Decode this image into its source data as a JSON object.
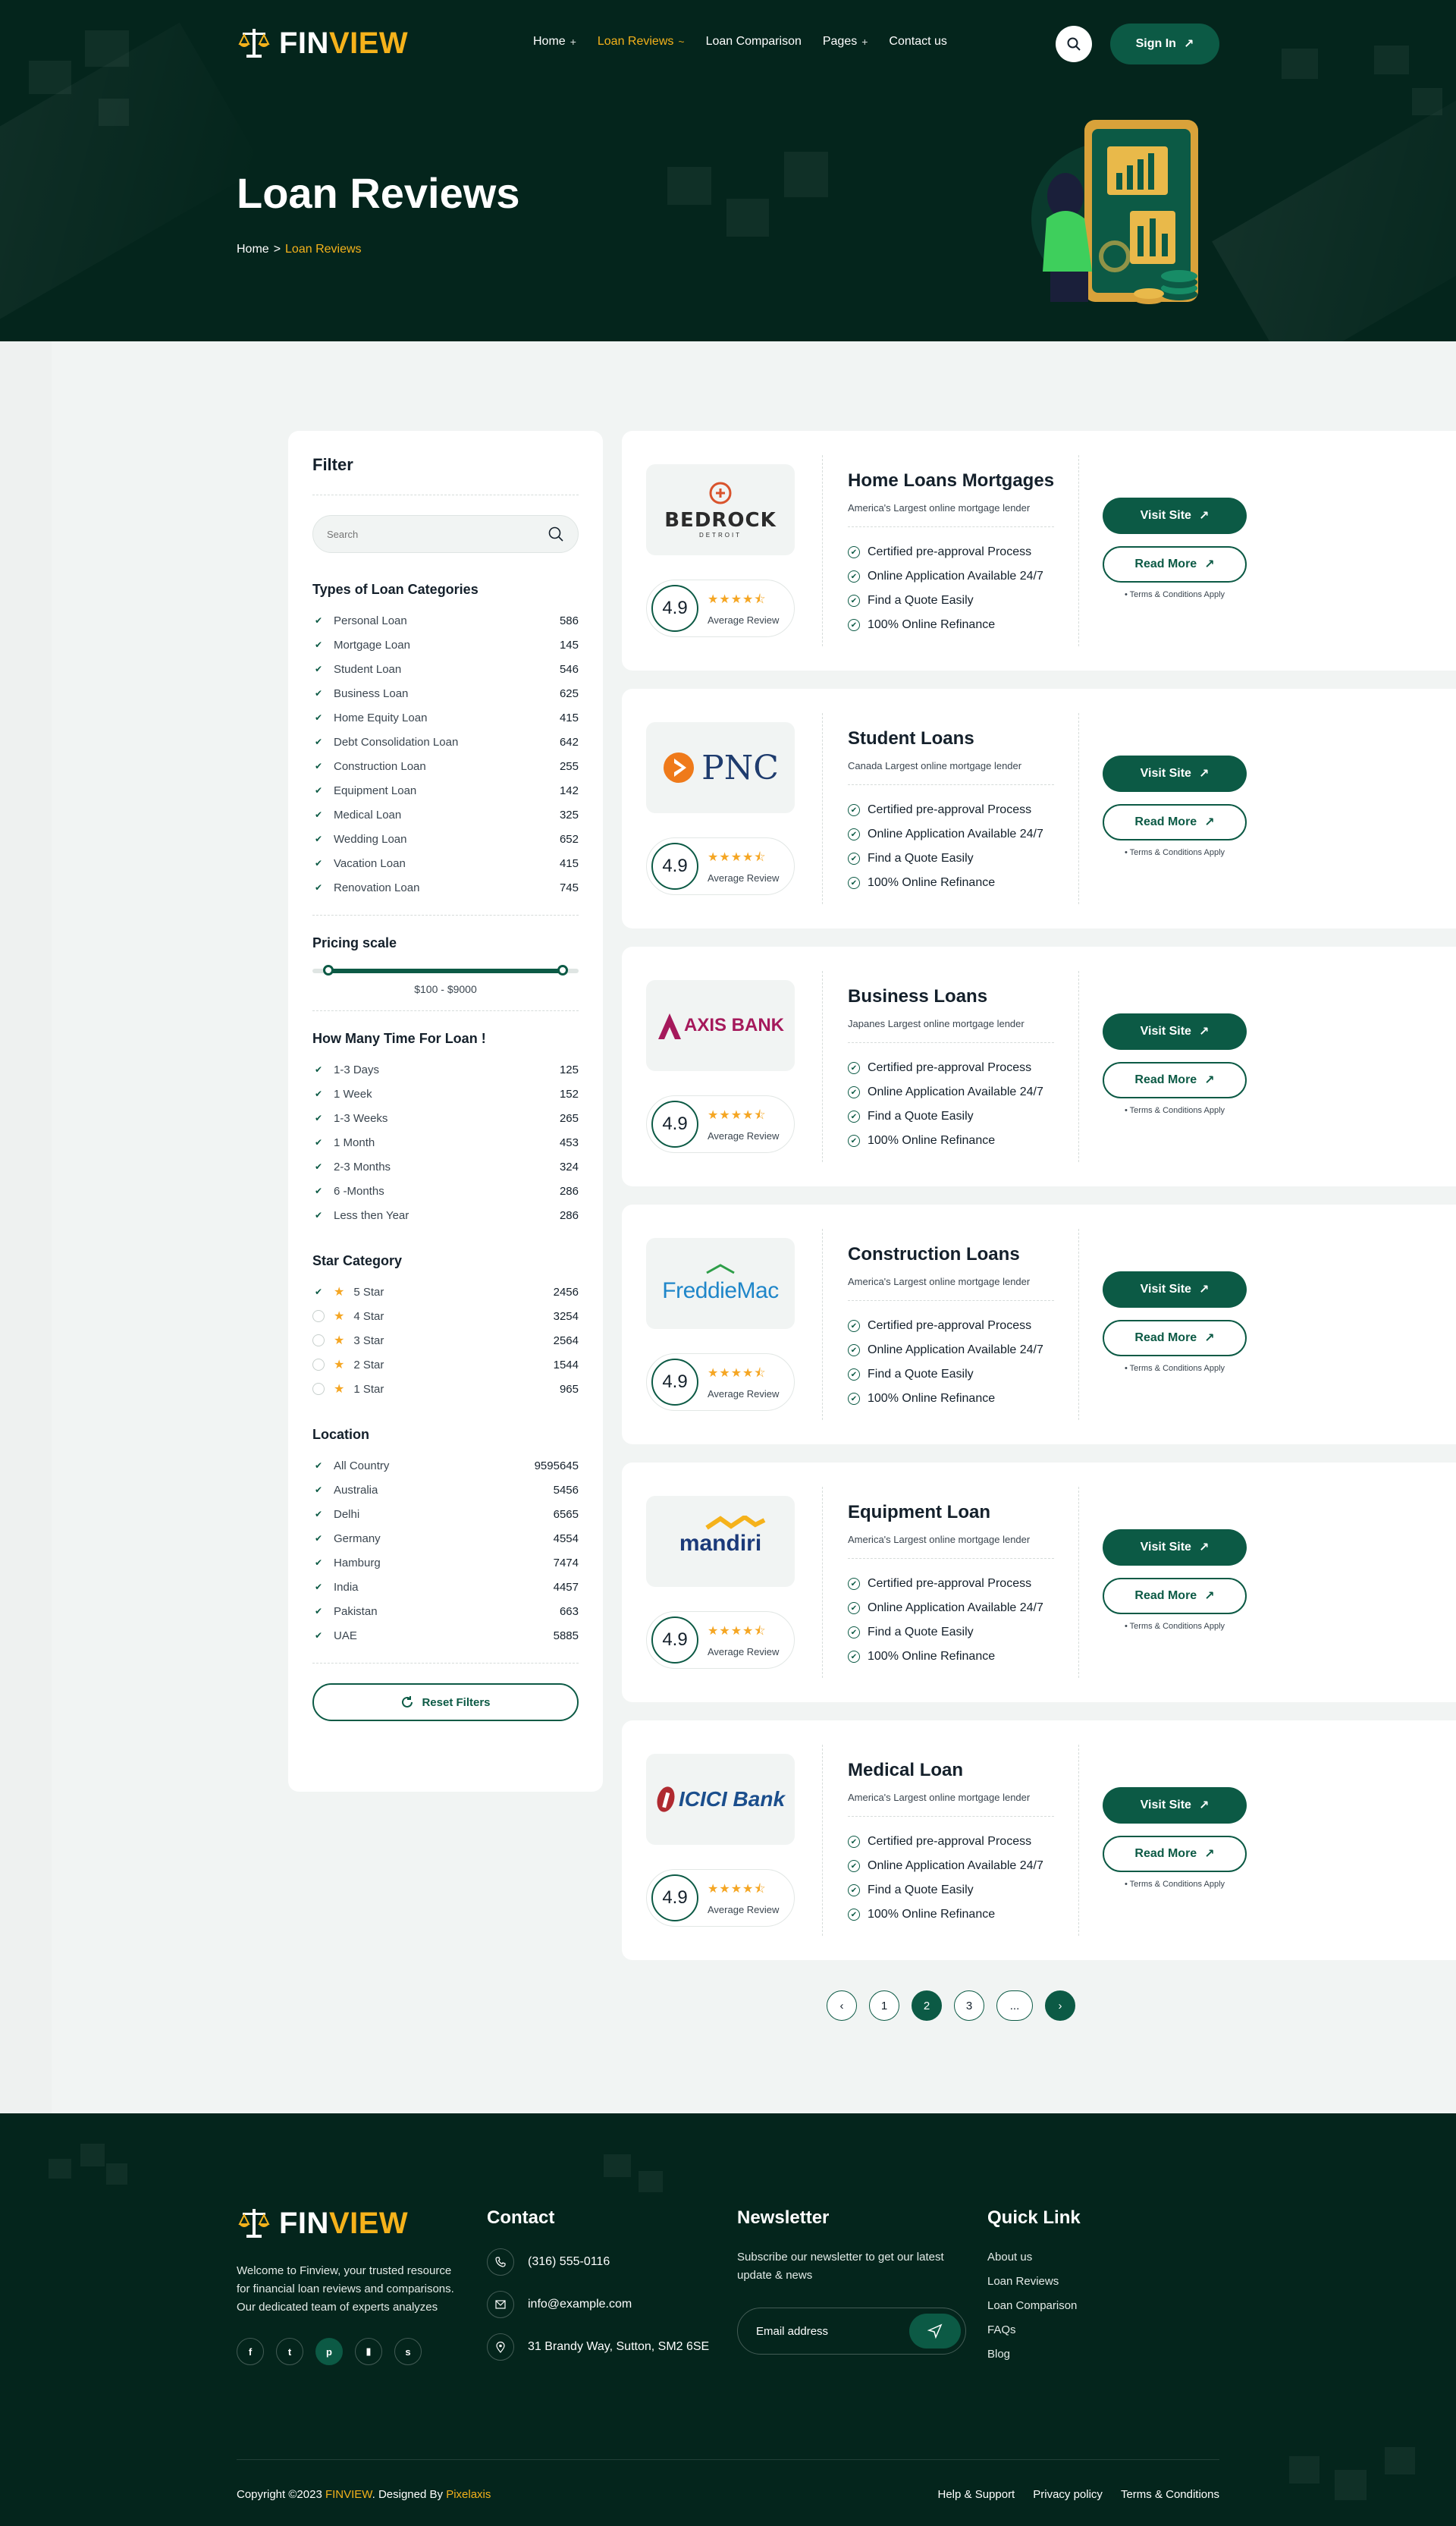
{
  "brand": {
    "name_part1": "FIN",
    "name_part2": "VIEW"
  },
  "nav": {
    "items": [
      {
        "label": "Home",
        "suffix": "+"
      },
      {
        "label": "Loan Reviews",
        "suffix": "~",
        "active": true
      },
      {
        "label": "Loan Comparison",
        "suffix": ""
      },
      {
        "label": "Pages",
        "suffix": "+"
      },
      {
        "label": "Contact us",
        "suffix": ""
      }
    ],
    "signin": "Sign In"
  },
  "hero": {
    "title": "Loan Reviews",
    "breadcrumb": {
      "home": "Home",
      "sep": ">",
      "current": "Loan Reviews"
    }
  },
  "filter": {
    "title": "Filter",
    "search_placeholder": "Search",
    "loan_types": {
      "heading": "Types of Loan Categories",
      "items": [
        {
          "label": "Personal Loan",
          "count": "586"
        },
        {
          "label": "Mortgage Loan",
          "count": "145"
        },
        {
          "label": "Student Loan",
          "count": "546"
        },
        {
          "label": "Business Loan",
          "count": "625"
        },
        {
          "label": "Home Equity Loan",
          "count": "415"
        },
        {
          "label": "Debt Consolidation Loan",
          "count": "642"
        },
        {
          "label": "Construction Loan",
          "count": "255"
        },
        {
          "label": "Equipment Loan",
          "count": "142"
        },
        {
          "label": "Medical Loan",
          "count": "325"
        },
        {
          "label": "Wedding Loan",
          "count": "652"
        },
        {
          "label": "Vacation Loan",
          "count": "415"
        },
        {
          "label": "Renovation Loan",
          "count": "745"
        }
      ]
    },
    "pricing": {
      "heading": "Pricing scale",
      "range_label": "$100 - $9000",
      "min_fraction": 0.06,
      "max_fraction": 0.94
    },
    "duration": {
      "heading": "How Many Time For Loan !",
      "items": [
        {
          "label": "1-3 Days",
          "count": "125"
        },
        {
          "label": "1 Week",
          "count": "152"
        },
        {
          "label": "1-3 Weeks",
          "count": "265"
        },
        {
          "label": "1 Month",
          "count": "453"
        },
        {
          "label": "2-3 Months",
          "count": "324"
        },
        {
          "label": "6 -Months",
          "count": "286"
        },
        {
          "label": "Less then Year",
          "count": "286"
        }
      ]
    },
    "stars": {
      "heading": "Star Category",
      "items": [
        {
          "label": "5 Star",
          "count": "2456",
          "checked": true
        },
        {
          "label": "4 Star",
          "count": "3254",
          "checked": false
        },
        {
          "label": "3 Star",
          "count": "2564",
          "checked": false
        },
        {
          "label": "2 Star",
          "count": "1544",
          "checked": false
        },
        {
          "label": "1 Star",
          "count": "965",
          "checked": false
        }
      ]
    },
    "location": {
      "heading": "Location",
      "items": [
        {
          "label": "All Country",
          "count": "9595645"
        },
        {
          "label": "Australia",
          "count": "5456"
        },
        {
          "label": "Delhi",
          "count": "6565"
        },
        {
          "label": "Germany",
          "count": "4554"
        },
        {
          "label": "Hamburg",
          "count": "7474"
        },
        {
          "label": "India",
          "count": "4457"
        },
        {
          "label": "Pakistan",
          "count": "663"
        },
        {
          "label": "UAE",
          "count": "5885"
        }
      ]
    },
    "reset": "Reset Filters"
  },
  "cards": [
    {
      "lender": "BEDROCK",
      "lender_sub": "DETROIT",
      "title": "Home Loans Mortgages",
      "subtitle": "America's Largest online mortgage lender",
      "rating": "4.9",
      "rating_label": "Average Review",
      "features": [
        "Certified pre-approval Process",
        "Online Application Available 24/7",
        "Find a Quote Easily",
        "100% Online Refinance"
      ],
      "visit": "Visit Site",
      "read": "Read More",
      "terms": "• Terms & Conditions Apply"
    },
    {
      "lender": "PNC",
      "title": "Student Loans",
      "subtitle": "Canada Largest online mortgage lender",
      "rating": "4.9",
      "rating_label": "Average Review",
      "features": [
        "Certified pre-approval Process",
        "Online Application Available 24/7",
        "Find a Quote Easily",
        "100% Online Refinance"
      ],
      "visit": "Visit Site",
      "read": "Read More",
      "terms": "• Terms & Conditions Apply"
    },
    {
      "lender": "AXIS BANK",
      "title": "Business Loans",
      "subtitle": "Japanes Largest online mortgage lender",
      "rating": "4.9",
      "rating_label": "Average Review",
      "features": [
        "Certified pre-approval Process",
        "Online Application Available 24/7",
        "Find a Quote Easily",
        "100% Online Refinance"
      ],
      "visit": "Visit Site",
      "read": "Read More",
      "terms": "• Terms & Conditions Apply"
    },
    {
      "lender": "FreddieMac",
      "title": "Construction Loans",
      "subtitle": "America's Largest online mortgage lender",
      "rating": "4.9",
      "rating_label": "Average Review",
      "features": [
        "Certified pre-approval Process",
        "Online Application Available 24/7",
        "Find a Quote Easily",
        "100% Online Refinance"
      ],
      "visit": "Visit Site",
      "read": "Read More",
      "terms": "• Terms & Conditions Apply"
    },
    {
      "lender": "mandiri",
      "title": "Equipment Loan",
      "subtitle": "America's Largest online mortgage lender",
      "rating": "4.9",
      "rating_label": "Average Review",
      "features": [
        "Certified pre-approval Process",
        "Online Application Available 24/7",
        "Find a Quote Easily",
        "100% Online Refinance"
      ],
      "visit": "Visit Site",
      "read": "Read More",
      "terms": "• Terms & Conditions Apply"
    },
    {
      "lender": "ICICI Bank",
      "title": "Medical Loan",
      "subtitle": "America's Largest online mortgage lender",
      "rating": "4.9",
      "rating_label": "Average Review",
      "features": [
        "Certified pre-approval Process",
        "Online Application Available 24/7",
        "Find a Quote Easily",
        "100% Online Refinance"
      ],
      "visit": "Visit Site",
      "read": "Read More",
      "terms": "• Terms & Conditions Apply"
    }
  ],
  "pagination": {
    "pages": [
      "1",
      "2",
      "3",
      "..."
    ],
    "current": "2"
  },
  "footer": {
    "about": "Welcome to Finview, your trusted resource for financial loan reviews and comparisons. Our dedicated team of experts analyzes",
    "contact": {
      "heading": "Contact",
      "phone": "(316) 555-0116",
      "email": "info@example.com",
      "address": "31 Brandy Way, Sutton, SM2 6SE"
    },
    "newsletter": {
      "heading": "Newsletter",
      "text": "Subscribe our newsletter to get our latest update & news",
      "placeholder": "Email address"
    },
    "quick": {
      "heading": "Quick Link",
      "links": [
        "About us",
        "Loan Reviews",
        "Loan Comparison",
        "FAQs",
        "Blog"
      ]
    },
    "copyright": {
      "pre": "Copyright ©2023 ",
      "brand": "FINVIEW",
      "mid": ". Designed By ",
      "designer": "Pixelaxis"
    },
    "bottom_links": [
      "Help & Support",
      "Privacy policy",
      "Terms & Conditions"
    ]
  },
  "colors": {
    "primary": "#0c5a45",
    "dark": "#04251c",
    "accent": "#f5b21b",
    "star": "#f5a623"
  }
}
